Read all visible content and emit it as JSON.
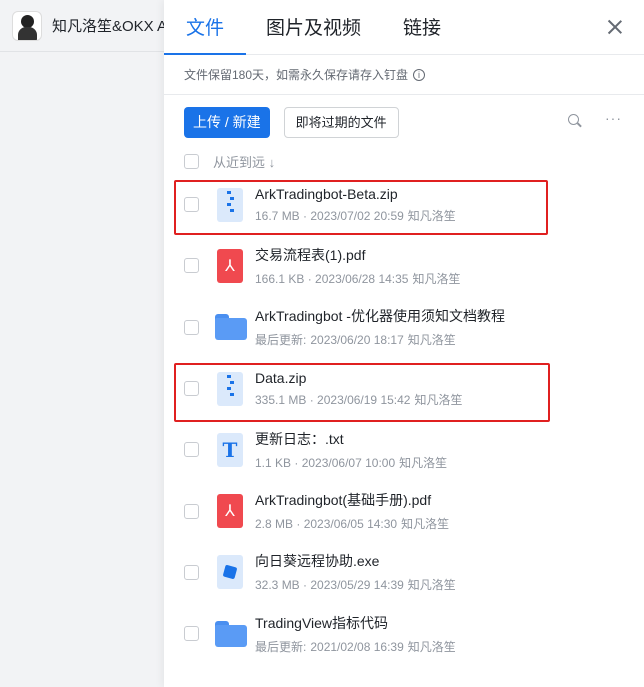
{
  "chat": {
    "title": "知凡洛笙&OKX A"
  },
  "tabs": [
    {
      "label": "文件",
      "active": true
    },
    {
      "label": "图片及视频",
      "active": false
    },
    {
      "label": "链接",
      "active": false
    }
  ],
  "notice": "文件保留180天，如需永久保存请存入钉盘",
  "toolbar": {
    "upload_label": "上传 / 新建",
    "expiring_label": "即将过期的文件"
  },
  "sort": {
    "label": "从近到远 ↓"
  },
  "files": [
    {
      "name": "ArkTradingbot-Beta.zip",
      "size": "16.7 MB",
      "date": "2023/07/02 20:59",
      "owner": "知凡洛笙",
      "icon": "zip-file-icon",
      "highlighted": true
    },
    {
      "name": "交易流程表(1).pdf",
      "size": "166.1 KB",
      "date": "2023/06/28 14:35",
      "owner": "知凡洛笙",
      "icon": "pdf-file-icon",
      "highlighted": false
    },
    {
      "name": "ArkTradingbot -优化器使用须知文档教程",
      "size": "最后更新:",
      "date": "2023/06/20 18:17",
      "owner": "知凡洛笙",
      "icon": "folder-icon",
      "highlighted": false
    },
    {
      "name": "Data.zip",
      "size": "335.1 MB",
      "date": "2023/06/19 15:42",
      "owner": "知凡洛笙",
      "icon": "zip-file-icon",
      "highlighted": true
    },
    {
      "name": "更新日志：.txt",
      "size": "1.1 KB",
      "date": "2023/06/07 10:00",
      "owner": "知凡洛笙",
      "icon": "txt-file-icon",
      "highlighted": false
    },
    {
      "name": "ArkTradingbot(基础手册).pdf",
      "size": "2.8 MB",
      "date": "2023/06/05 14:30",
      "owner": "知凡洛笙",
      "icon": "pdf-file-icon",
      "highlighted": false
    },
    {
      "name": "向日葵远程协助.exe",
      "size": "32.3 MB",
      "date": "2023/05/29 14:39",
      "owner": "知凡洛笙",
      "icon": "exe-file-icon",
      "highlighted": false
    },
    {
      "name": "TradingView指标代码",
      "size": "最后更新:",
      "date": "2021/02/08 16:39",
      "owner": "知凡洛笙",
      "icon": "folder-icon",
      "highlighted": false
    }
  ],
  "colors": {
    "accent": "#1a73e8",
    "highlight": "#e02020",
    "pdf": "#f0494f"
  }
}
